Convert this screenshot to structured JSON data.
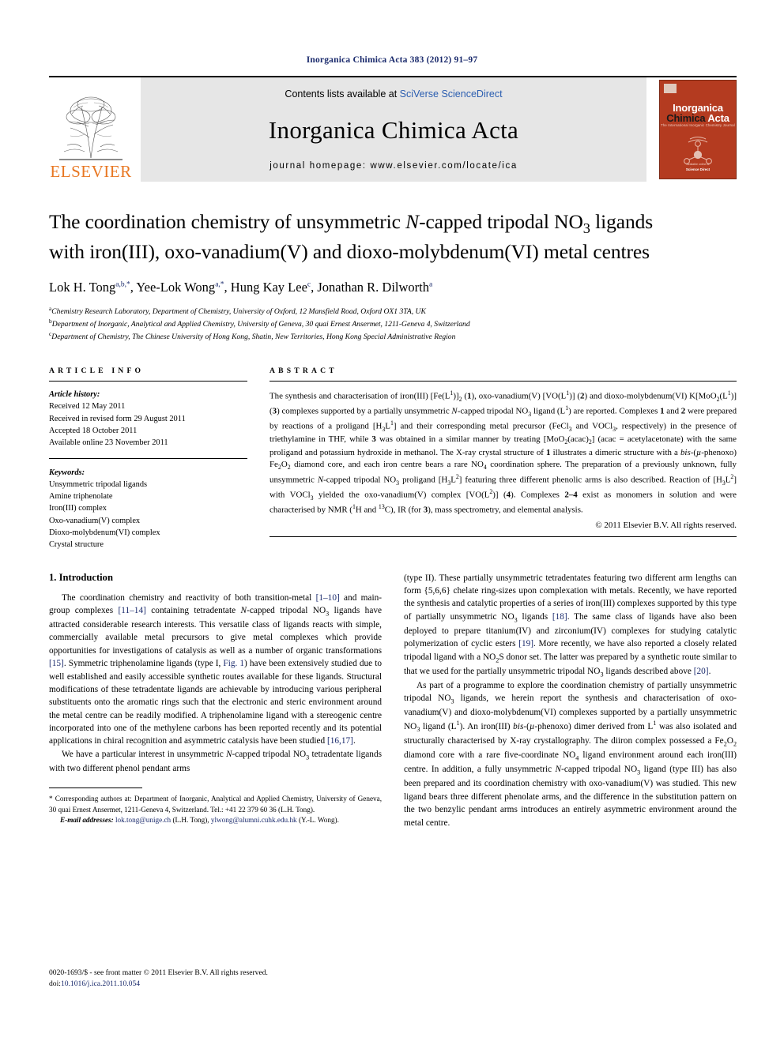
{
  "running_head": "Inorganica Chimica Acta 383 (2012) 91–97",
  "masthead": {
    "contents_prefix": "Contents lists available at ",
    "contents_link": "SciVerse ScienceDirect",
    "journal_name": "Inorganica Chimica Acta",
    "homepage": "journal homepage: www.elsevier.com/locate/ica",
    "publisher": "ELSEVIER",
    "cover": {
      "line1": "Inorganica",
      "line2a": "Chimica",
      "line2b": "Acta",
      "tagline": "The International Inorganic Chemistry Journal",
      "foot_small": "Available online at",
      "foot_bold": "Science Direct"
    },
    "link_color": "#2a5db0",
    "elsevier_orange": "#E87722",
    "cover_red": "#b43b20"
  },
  "article": {
    "title_line1_a": "The coordination chemistry of unsymmetric ",
    "title_line1_i": "N",
    "title_line1_b": "-capped tripodal NO",
    "title_line1_sub": "3",
    "title_line1_c": " ligands",
    "title_line2": "with iron(III), oxo-vanadium(V) and dioxo-molybdenum(VI) metal centres",
    "authors": [
      {
        "name": "Lok H. Tong",
        "sup": "a,b,*"
      },
      {
        "name": "Yee-Lok Wong",
        "sup": "a,*"
      },
      {
        "name": "Hung Kay Lee",
        "sup": "c"
      },
      {
        "name": "Jonathan R. Dilworth",
        "sup": "a"
      }
    ],
    "affiliations": [
      {
        "mark": "a",
        "text": "Chemistry Research Laboratory, Department of Chemistry, University of Oxford, 12 Mansfield Road, Oxford OX1 3TA, UK"
      },
      {
        "mark": "b",
        "text": "Department of Inorganic, Analytical and Applied Chemistry, University of Geneva, 30 quai Ernest Ansermet, 1211-Geneva 4, Switzerland"
      },
      {
        "mark": "c",
        "text": "Department of Chemistry, The Chinese University of Hong Kong, Shatin, New Territories, Hong Kong Special Administrative Region"
      }
    ]
  },
  "info": {
    "heading": "ARTICLE INFO",
    "history_label": "Article history:",
    "history": [
      "Received 12 May 2011",
      "Received in revised form 29 August 2011",
      "Accepted 18 October 2011",
      "Available online 23 November 2011"
    ],
    "keywords_label": "Keywords:",
    "keywords": [
      "Unsymmetric tripodal ligands",
      "Amine triphenolate",
      "Iron(III) complex",
      "Oxo-vanadium(V) complex",
      "Dioxo-molybdenum(VI) complex",
      "Crystal structure"
    ]
  },
  "abstract": {
    "heading": "ABSTRACT",
    "copyright": "© 2011 Elsevier B.V. All rights reserved."
  },
  "introduction": {
    "heading": "1. Introduction"
  },
  "footnote": {
    "corresponding_mark": "*",
    "corresponding": "Corresponding authors at: Department of Inorganic, Analytical and Applied Chemistry, University of Geneva, 30 quai Ernest Ansermet, 1211-Geneva 4, Switzerland. Tel.: +41 22 379 60 36 (L.H. Tong).",
    "email_label": "E-mail addresses:",
    "email1": "lok.tong@unige.ch",
    "email1_owner": "(L.H. Tong),",
    "email2": "ylwong@alumni.cuhk.edu.hk",
    "email2_owner": "(Y.-L. Wong)."
  },
  "issn": {
    "line1": "0020-1693/$ - see front matter © 2011 Elsevier B.V. All rights reserved.",
    "doi_prefix": "doi:",
    "doi": "10.1016/j.ica.2011.10.054"
  }
}
